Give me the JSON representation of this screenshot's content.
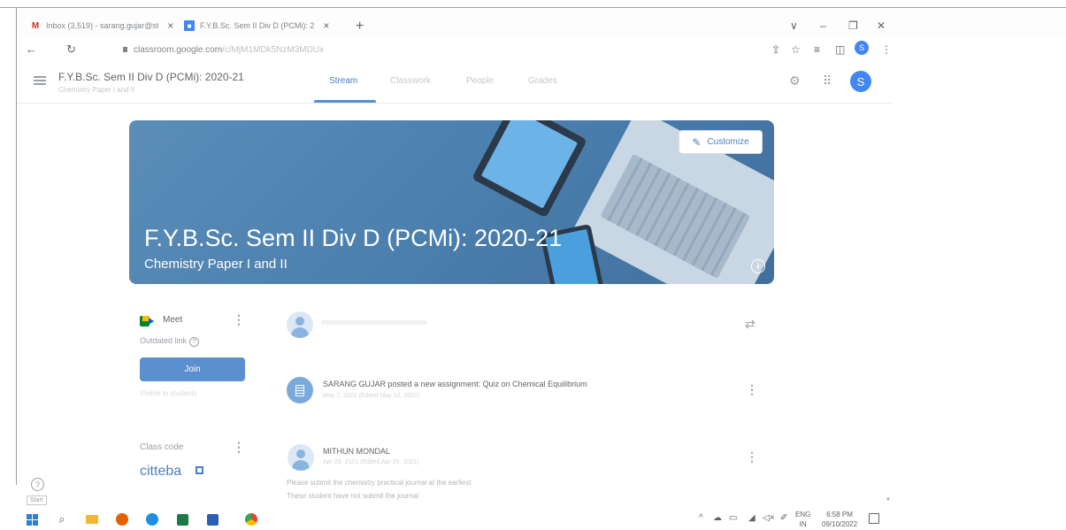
{
  "browser": {
    "tabs": [
      {
        "title": "Inbox (3,519) - sarang.gujar@st",
        "favicon": "gmail-icon"
      },
      {
        "title": "F.Y.B.Sc. Sem II Div D (PCMi): 2",
        "favicon": "classroom-icon"
      }
    ],
    "url_host": "classroom.google.com",
    "url_path": "/c/MjM1MDk5NzM3MDUx",
    "profile_initial": "S"
  },
  "classroom": {
    "class_name": "F.Y.B.Sc. Sem II Div D (PCMi): 2020-21",
    "class_section": "Chemistry Paper I and II",
    "nav_tabs": [
      "Stream",
      "Classwork",
      "People",
      "Grades"
    ],
    "avatar_initial": "S"
  },
  "banner": {
    "title": "F.Y.B.Sc. Sem II Div D (PCMi): 2020-21",
    "subtitle": "Chemistry Paper I and II",
    "customize_label": "Customize"
  },
  "meet": {
    "label": "Meet",
    "outdated": "Outdated link",
    "join_label": "Join",
    "visibility": "Visible to students"
  },
  "class_code": {
    "label": "Class code",
    "value": "citteba"
  },
  "stream": {
    "share_placeholder": "",
    "posts": [
      {
        "text": "SARANG GUJAR posted a new assignment: Quiz on Chemical Equilibrium",
        "date": "May 7, 2021 (Edited May 12, 2021)"
      },
      {
        "author": "MITHUN MONDAL",
        "date": "Apr 29, 2021 (Edited Apr 29, 2021)",
        "body_line1": "Please submit the chemistry practical journal at the earliest",
        "body_line2": "These student have not submit the journal"
      }
    ]
  },
  "help": {
    "start_tooltip": "Start"
  },
  "taskbar": {
    "lang_line1": "ENG",
    "lang_line2": "IN",
    "time": "6:58 PM",
    "date": "09/10/2022"
  }
}
